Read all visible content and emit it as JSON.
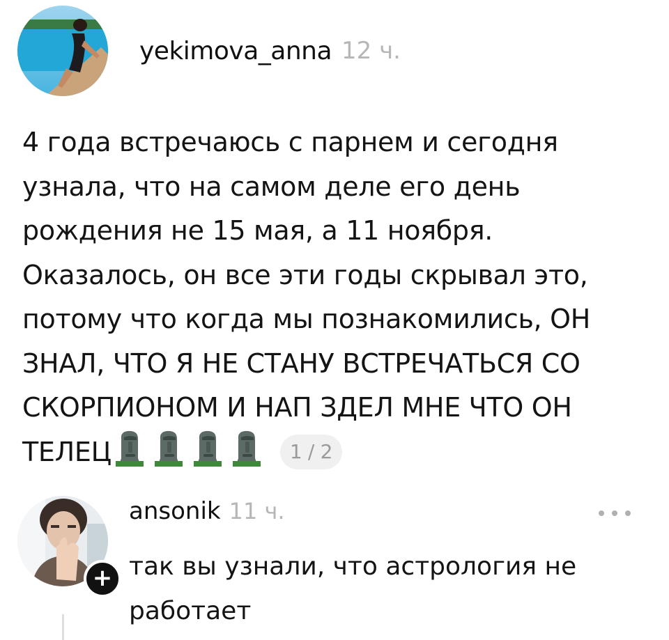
{
  "post": {
    "username": "yekimova_anna",
    "time": "12 ч.",
    "lines": [
      "4 года встречаюсь с парнем и сегодня",
      "узнала, что на самом деле его день",
      "рождения не 15 мая, а 11 ноября.",
      "Оказалось, он все эти годы скрывал это,",
      "потому что когда мы познакомились, ОН",
      "ЗНАЛ, ЧТО Я НЕ СТАНУ ВСТРЕЧАТЬСЯ СО",
      "СКОРПИОНОМ И НАП ЗДЕЛ МНЕ ЧТО ОН",
      "ТЕЛЕЦ"
    ],
    "emoji_count": 4,
    "emoji_icon": "moai-icon",
    "page_indicator": "1 / 2"
  },
  "comment": {
    "username": "ansonik",
    "time": "11 ч.",
    "text_lines": [
      "так вы узнали, что астрология не",
      "работает"
    ],
    "follow_badge": "+",
    "more_icon": "more-dots-icon"
  },
  "colors": {
    "text": "#141414",
    "muted": "#b6b6b6",
    "pill_bg": "#f0f0f0"
  }
}
